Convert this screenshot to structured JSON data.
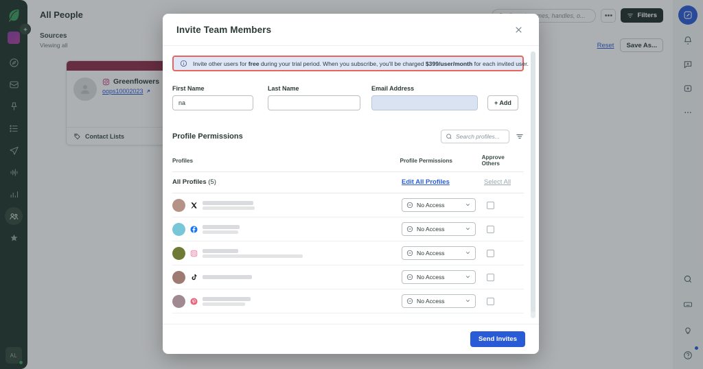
{
  "left_rail": {
    "logo_icon": "leaf-logo-icon",
    "workspace_avatar": "workspace-avatar",
    "items": [
      {
        "icon": "compass-icon",
        "active": false
      },
      {
        "icon": "inbox-icon",
        "active": false
      },
      {
        "icon": "pin-icon",
        "active": false
      },
      {
        "icon": "list-icon",
        "active": false
      },
      {
        "icon": "send-icon",
        "active": false
      },
      {
        "icon": "listening-icon",
        "active": false
      },
      {
        "icon": "reports-bar-chart-icon",
        "active": false
      },
      {
        "icon": "people-icon",
        "active": true
      },
      {
        "icon": "star-badge-icon",
        "active": false
      }
    ],
    "user_initials": "AL"
  },
  "page": {
    "title": "All People",
    "sources_label": "Sources",
    "sources_sub": "Viewing all",
    "collapse_icon": "plus-icon",
    "search": {
      "placeholder": "Search names, handles, o...",
      "icon": "search-icon"
    },
    "ellipsis_label": "•••",
    "filters_label": "Filters",
    "filters_icon": "filter-icon",
    "reset_label": "Reset",
    "save_as_label": "Save As...",
    "profile_card": {
      "name": "Greenflowers",
      "platform_icon": "instagram-icon",
      "handle": "oops10002023",
      "external_link_icon": "external-link-icon",
      "footer_label": "Contact Lists",
      "footer_icon": "tag-icon",
      "banner_color": "#8f2c4a"
    }
  },
  "right_rail": {
    "compose_icon": "compose-pencil-icon",
    "items": [
      {
        "icon": "bell-icon"
      },
      {
        "icon": "message-plus-icon"
      },
      {
        "icon": "add-square-icon"
      },
      {
        "icon": "more-dots-icon"
      }
    ],
    "bottom_items": [
      {
        "icon": "search-icon"
      },
      {
        "icon": "keyboard-icon"
      },
      {
        "icon": "lightbulb-icon"
      },
      {
        "icon": "help-circle-icon"
      }
    ]
  },
  "modal": {
    "title": "Invite Team Members",
    "close_icon": "close-icon",
    "banner": {
      "icon": "info-circle-icon",
      "text_1": "Invite other users for ",
      "bold_1": "free",
      "text_2": " during your trial period. When you subscribe, you'll be charged ",
      "bold_2": "$399/user/month",
      "text_3": " for each invited user.",
      "border_color": "#e8645f",
      "background_color": "#dfe6f6"
    },
    "form": {
      "first_name": {
        "label": "First Name",
        "value": "na",
        "placeholder": ""
      },
      "last_name": {
        "label": "Last Name",
        "value": "",
        "placeholder": ""
      },
      "email": {
        "label": "Email Address",
        "value": "",
        "placeholder": ""
      },
      "add_button": "+ Add"
    },
    "permissions": {
      "section_title": "Profile Permissions",
      "search_placeholder": "Search profiles...",
      "search_icon": "search-icon",
      "filter_icon": "filter-lines-icon",
      "columns": [
        "Profiles",
        "Profile Permissions",
        "Approve Others"
      ],
      "all_profiles_label": "All Profiles",
      "all_profiles_count": "(5)",
      "edit_all_label": "Edit All Profiles",
      "select_all_label": "Select All",
      "rows": [
        {
          "platform": "x-twitter-icon",
          "avatar_color": "#b59287",
          "name_redacted_width": 74,
          "sub_redacted_width": 76,
          "permission": "No Access",
          "permission_icon": "no-access-icon",
          "chevron_icon": "chevron-down-icon",
          "approve_checked": false
        },
        {
          "platform": "facebook-icon",
          "avatar_color": "#78c7d8",
          "name_redacted_width": 54,
          "sub_redacted_width": 52,
          "permission": "No Access",
          "permission_icon": "no-access-icon",
          "chevron_icon": "chevron-down-icon",
          "approve_checked": false
        },
        {
          "platform": "instagram-icon",
          "avatar_color": "#6f7a37",
          "name_redacted_width": 52,
          "sub_redacted_width": 146,
          "permission": "No Access",
          "permission_icon": "no-access-icon",
          "chevron_icon": "chevron-down-icon",
          "approve_checked": false
        },
        {
          "platform": "tiktok-icon",
          "avatar_color": "#9d7b72",
          "name_redacted_width": 72,
          "sub_redacted_width": 0,
          "permission": "No Access",
          "permission_icon": "no-access-icon",
          "chevron_icon": "chevron-down-icon",
          "approve_checked": false
        },
        {
          "platform": "pinterest-icon",
          "avatar_color": "#a08a92",
          "name_redacted_width": 70,
          "sub_redacted_width": 62,
          "permission": "No Access",
          "permission_icon": "no-access-icon",
          "chevron_icon": "chevron-down-icon",
          "approve_checked": false
        }
      ]
    },
    "footer": {
      "send_label": "Send Invites",
      "send_color": "#2a5bd7"
    }
  }
}
